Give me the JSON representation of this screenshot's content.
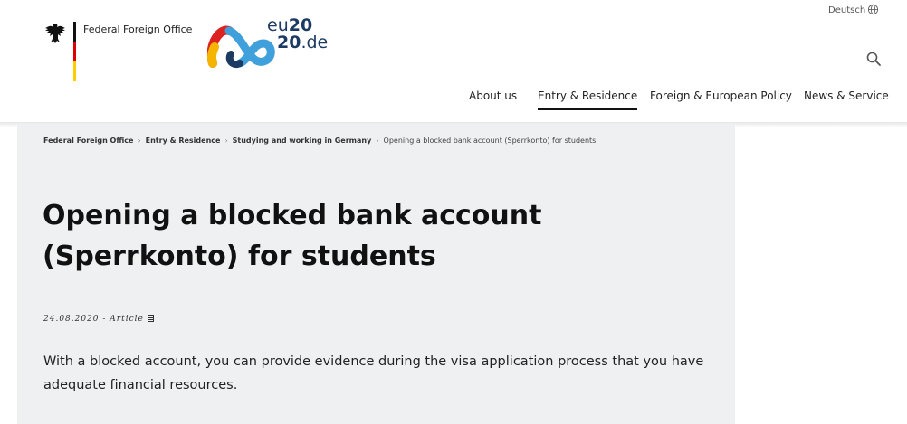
{
  "header": {
    "ministry_name": "Federal Foreign Office",
    "eu_logo_line1_a": "eu",
    "eu_logo_line1_b": "20",
    "eu_logo_line2_a": "20",
    "eu_logo_line2_b": ".de",
    "language_label": "Deutsch",
    "icons": [
      "eagle-icon",
      "globe-icon",
      "search-icon",
      "document-icon"
    ],
    "nav": [
      {
        "label": "About us",
        "active": false
      },
      {
        "label": "Entry & Residence",
        "active": true
      },
      {
        "label": "Foreign & European Policy",
        "active": false
      },
      {
        "label": "News & Service",
        "active": false
      }
    ]
  },
  "breadcrumb": [
    "Federal Foreign Office",
    "Entry & Residence",
    "Studying and working in Germany",
    "Opening a blocked bank account (Sperrkonto) for students"
  ],
  "article": {
    "title": "Opening a blocked bank account (Sperrkonto) for students",
    "meta": "24.08.2020 - Article",
    "intro": "With a blocked account, you can provide evidence during the visa application process that you have adequate financial resources."
  },
  "colors": {
    "panel_background": "#eef0f2",
    "flag_black": "#111111",
    "flag_red": "#dd0000",
    "flag_gold": "#ffcc00",
    "eu_blue": "#1d3a63"
  }
}
